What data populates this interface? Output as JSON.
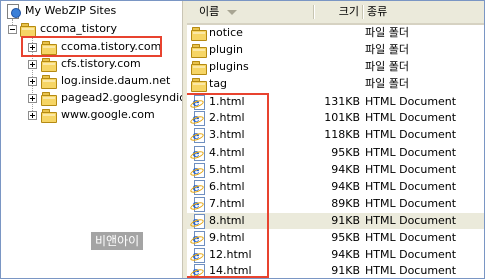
{
  "tree": {
    "root_label": "My WebZIP Sites",
    "project_label": "ccoma_tistory",
    "sites": [
      {
        "label": "ccoma.tistory.com"
      },
      {
        "label": "cfs.tistory.com"
      },
      {
        "label": "log.inside.daum.net"
      },
      {
        "label": "pagead2.googlesyndication.com"
      },
      {
        "label": "www.google.com"
      }
    ]
  },
  "list": {
    "columns": {
      "name": "이름",
      "size": "크기",
      "type": "종류"
    },
    "folders": [
      {
        "name": "notice",
        "type": "파일 폴더"
      },
      {
        "name": "plugin",
        "type": "파일 폴더"
      },
      {
        "name": "plugins",
        "type": "파일 폴더"
      },
      {
        "name": "tag",
        "type": "파일 폴더"
      }
    ],
    "files": [
      {
        "name": "1.html",
        "size": "131KB",
        "type": "HTML Document"
      },
      {
        "name": "2.html",
        "size": "101KB",
        "type": "HTML Document"
      },
      {
        "name": "3.html",
        "size": "118KB",
        "type": "HTML Document"
      },
      {
        "name": "4.html",
        "size": "95KB",
        "type": "HTML Document"
      },
      {
        "name": "5.html",
        "size": "94KB",
        "type": "HTML Document"
      },
      {
        "name": "6.html",
        "size": "94KB",
        "type": "HTML Document"
      },
      {
        "name": "7.html",
        "size": "89KB",
        "type": "HTML Document"
      },
      {
        "name": "8.html",
        "size": "91KB",
        "type": "HTML Document"
      },
      {
        "name": "9.html",
        "size": "95KB",
        "type": "HTML Document"
      },
      {
        "name": "12.html",
        "size": "94KB",
        "type": "HTML Document"
      },
      {
        "name": "14.html",
        "size": "91KB",
        "type": "HTML Document"
      }
    ]
  },
  "watermark": "비앤아이",
  "colors": {
    "highlight": "#e8432f",
    "selection": "#ebeadb"
  }
}
